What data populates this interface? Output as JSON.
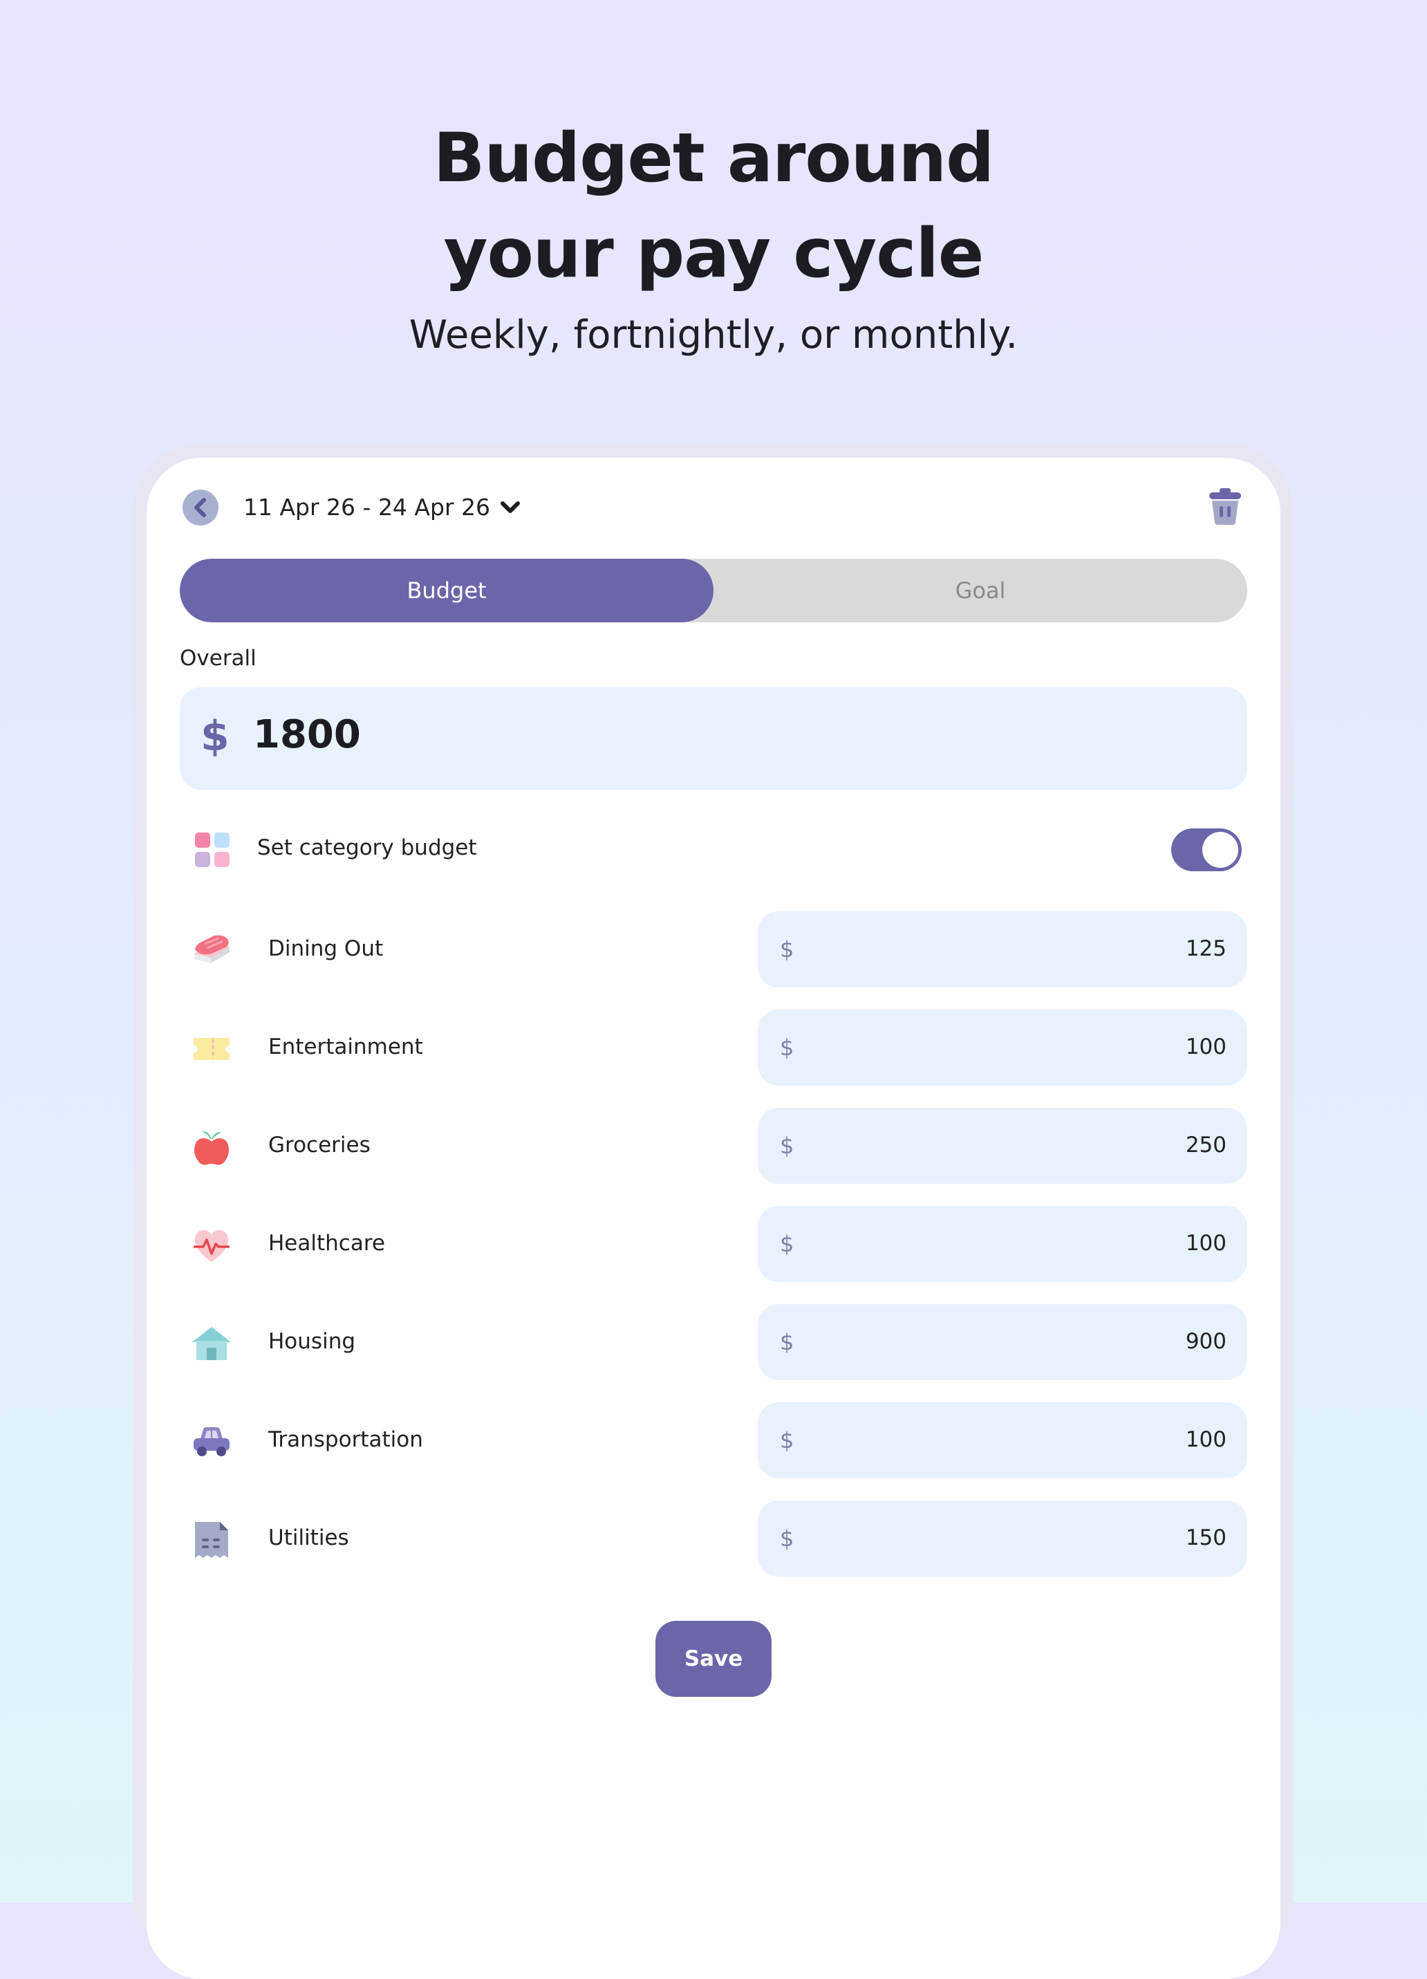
{
  "hero": {
    "title_line1": "Budget around",
    "title_line2": "your pay cycle",
    "subtitle": "Weekly, fortnightly, or monthly."
  },
  "header": {
    "date_range": "11 Apr 26 - 24 Apr 26",
    "back_icon": "chevron-left-icon",
    "dropdown_icon": "chevron-down-icon",
    "delete_icon": "trash-icon"
  },
  "tabs": [
    {
      "label": "Budget",
      "active": true
    },
    {
      "label": "Goal",
      "active": false
    }
  ],
  "overall": {
    "label": "Overall",
    "currency": "$",
    "value": "1800"
  },
  "category_toggle": {
    "label": "Set category budget",
    "enabled": true,
    "icon": "category-grid-icon"
  },
  "categories": [
    {
      "label": "Dining Out",
      "currency": "$",
      "value": "125",
      "icon": "sushi-icon"
    },
    {
      "label": "Entertainment",
      "currency": "$",
      "value": "100",
      "icon": "ticket-icon"
    },
    {
      "label": "Groceries",
      "currency": "$",
      "value": "250",
      "icon": "apple-icon"
    },
    {
      "label": "Healthcare",
      "currency": "$",
      "value": "100",
      "icon": "heart-pulse-icon"
    },
    {
      "label": "Housing",
      "currency": "$",
      "value": "900",
      "icon": "house-icon"
    },
    {
      "label": "Transportation",
      "currency": "$",
      "value": "100",
      "icon": "car-icon"
    },
    {
      "label": "Utilities",
      "currency": "$",
      "value": "150",
      "icon": "receipt-icon"
    }
  ],
  "actions": {
    "save_label": "Save"
  },
  "colors": {
    "accent": "#6b66aa",
    "input_bg": "#e8f2ff",
    "tab_inactive": "#d9d9d9"
  }
}
